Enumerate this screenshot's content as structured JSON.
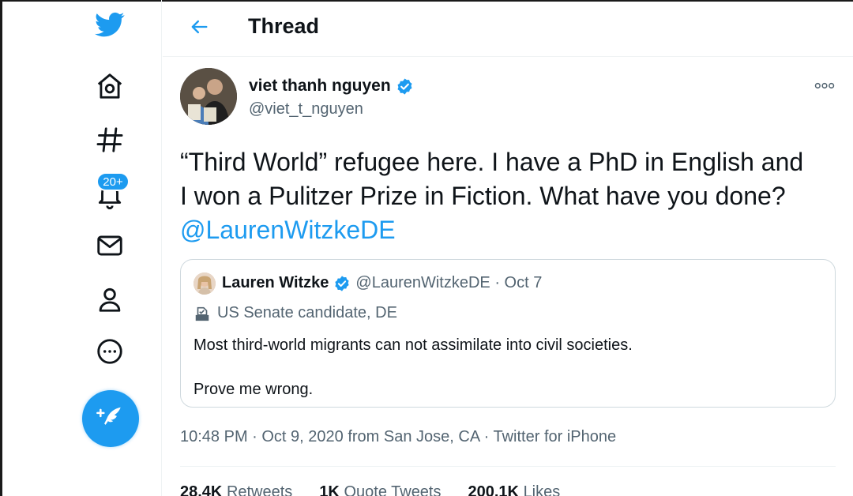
{
  "colors": {
    "accent": "#1d9bf0",
    "text": "#0f1419",
    "muted": "#536471"
  },
  "sidebar": {
    "items": [
      {
        "icon": "twitter-logo-icon"
      },
      {
        "icon": "home-icon"
      },
      {
        "icon": "explore-hashtag-icon"
      },
      {
        "icon": "notifications-bell-icon",
        "badge": "20+"
      },
      {
        "icon": "messages-mail-icon"
      },
      {
        "icon": "profile-person-icon"
      },
      {
        "icon": "more-circle-icon"
      }
    ],
    "fab_icon": "compose-tweet-icon"
  },
  "header": {
    "title": "Thread"
  },
  "tweet": {
    "author_name": "viet thanh nguyen",
    "handle": "@viet_t_nguyen",
    "text": "“Third World” refugee here. I have a PhD in English and I won a Pulitzer Prize in Fiction. What have you done? ",
    "mention": "@LaurenWitzkeDE",
    "timestamp": "10:48 PM · Oct 9, 2020 from San Jose, CA · Twitter for iPhone"
  },
  "quote": {
    "name": "Lauren Witzke",
    "handle_date": "@LaurenWitzkeDE · Oct 7",
    "label": "US Senate candidate, DE",
    "line1": "Most third-world migrants can not assimilate into civil societies.",
    "line2": "Prove me wrong."
  },
  "stats": [
    {
      "value": "28.4K",
      "label": "Retweets"
    },
    {
      "value": "1K",
      "label": "Quote Tweets"
    },
    {
      "value": "200.1K",
      "label": "Likes"
    }
  ]
}
